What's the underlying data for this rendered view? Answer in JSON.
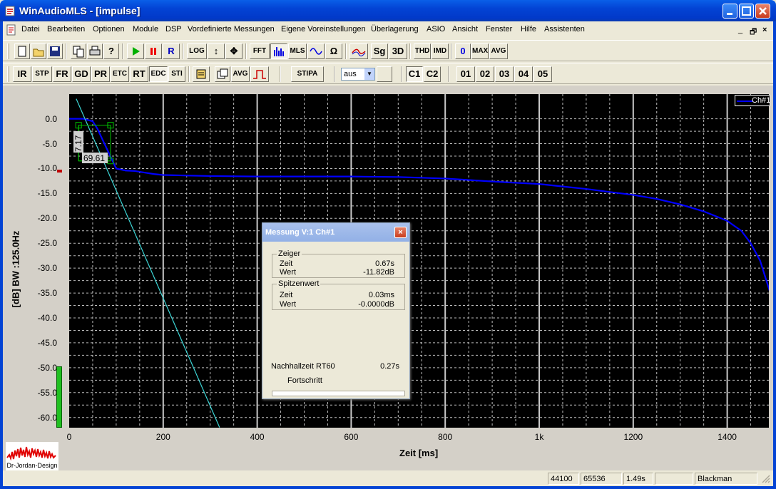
{
  "window": {
    "title": "WinAudioMLS - [impulse]"
  },
  "menu": {
    "items": [
      "Datei",
      "Bearbeiten",
      "Optionen",
      "Module",
      "DSP",
      "Vordefinierte Messungen",
      "Eigene Voreinstellungen",
      "Überlagerung",
      "ASIO",
      "Ansicht",
      "Fenster",
      "Hilfe",
      "Assistenten"
    ],
    "mdi_controls": [
      "_",
      "🗗",
      "×"
    ]
  },
  "toolbar1": {
    "buttons": [
      "new",
      "open",
      "save",
      "copy",
      "print",
      "help",
      "play",
      "pause",
      "R",
      "LOG",
      "↕",
      "✥",
      "FFT",
      "spectrum",
      "MLS",
      "wave",
      "Ω",
      "filter",
      "Sg",
      "3D",
      "THD",
      "IMD",
      "0",
      "MAX",
      "AVG"
    ]
  },
  "toolbar2": {
    "buttons": [
      "IR",
      "STP",
      "FR",
      "GD",
      "PR",
      "ETC",
      "RT",
      "EDC",
      "STI",
      "window-tool",
      "copy-tool",
      "AVG",
      "pulse",
      "STIPA"
    ],
    "select_value": "aus",
    "channels": [
      "C1",
      "C2"
    ],
    "presets": [
      "01",
      "02",
      "03",
      "04",
      "05"
    ]
  },
  "chart_data": {
    "type": "line",
    "title": "",
    "ylabel": "[dB] BW :125.0Hz",
    "xlabel": "Zeit [ms]",
    "ylim": [
      -62,
      2
    ],
    "xlim": [
      0,
      1490
    ],
    "yticks": [
      "0.0",
      "-5.0",
      "-10.0",
      "-15.0",
      "-20.0",
      "-25.0",
      "-30.0",
      "-35.0",
      "-40.0",
      "-45.0",
      "-50.0",
      "-55.0",
      "-60.0"
    ],
    "xticks": [
      "0",
      "200",
      "400",
      "600",
      "800",
      "1k",
      "1200",
      "1400"
    ],
    "legend": "Ch#1",
    "series": [
      {
        "name": "Ch#1",
        "color": "#0000ff",
        "x": [
          0,
          30,
          50,
          60,
          70,
          80,
          90,
          100,
          120,
          140,
          160,
          180,
          200,
          250,
          300,
          400,
          500,
          600,
          700,
          800,
          900,
          1000,
          1050,
          1100,
          1150,
          1200,
          1250,
          1300,
          1350,
          1400,
          1430,
          1450,
          1470,
          1480,
          1490
        ],
        "y": [
          0,
          0,
          -0.5,
          -2,
          -4,
          -6,
          -8,
          -10,
          -10.4,
          -10.5,
          -10.8,
          -11.1,
          -11.3,
          -11.4,
          -11.5,
          -11.6,
          -11.6,
          -11.6,
          -11.7,
          -12,
          -12.6,
          -13.1,
          -13.6,
          -14.1,
          -14.7,
          -15.3,
          -16.1,
          -17.2,
          -18.6,
          -20.5,
          -22.5,
          -25,
          -28.5,
          -31.5,
          -34.5
        ]
      },
      {
        "name": "",
        "color": "#3cd6d6",
        "x": [
          15,
          320
        ],
        "y": [
          4,
          -62
        ]
      }
    ],
    "cursor_labels": [
      "7.17",
      "69.61"
    ],
    "grid": true
  },
  "dialog": {
    "title": "Messung V:1 Ch#1",
    "close": "×",
    "zeiger": {
      "label": "Zeiger",
      "rows": [
        {
          "k": "Zeit",
          "v": "0.67s"
        },
        {
          "k": "Wert",
          "v": "-11.82dB"
        }
      ]
    },
    "spitzen": {
      "label": "Spitzenwert",
      "rows": [
        {
          "k": "Zeit",
          "v": "0.03ms"
        },
        {
          "k": "Wert",
          "v": "-0.0000dB"
        }
      ]
    },
    "rt60_label": "Nachhallzeit RT60",
    "rt60_value": "0.27s",
    "progress_label": "Fortschritt"
  },
  "status": {
    "fields": [
      "44100",
      "65536",
      "1.49s",
      "",
      "Blackman"
    ]
  },
  "logo": {
    "text": "Dr-Jordan-Design"
  }
}
